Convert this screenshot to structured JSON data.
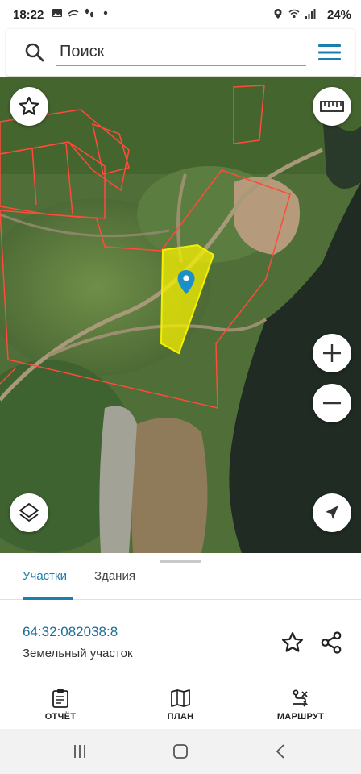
{
  "status_bar": {
    "time": "18:22",
    "battery": "24%",
    "left_icons": [
      "image-icon",
      "wind-icon",
      "footsteps-icon",
      "dot-icon"
    ],
    "right_icons": [
      "location-icon",
      "wifi-icon",
      "signal-icon"
    ]
  },
  "search": {
    "placeholder": "Поиск"
  },
  "map": {
    "parcel_color": "#f5f000",
    "boundary_color": "#ff4b3a",
    "marker_color": "#1b8fc9"
  },
  "sheet": {
    "tabs": [
      {
        "label": "Участки",
        "active": true
      },
      {
        "label": "Здания",
        "active": false
      }
    ],
    "parcel": {
      "number": "64:32:082038:8",
      "type": "Земельный участок"
    }
  },
  "toolbar": {
    "items": [
      {
        "label": "ОТЧЁТ",
        "icon": "clipboard-icon"
      },
      {
        "label": "ПЛАН",
        "icon": "map-book-icon"
      },
      {
        "label": "МАРШРУТ",
        "icon": "route-icon"
      }
    ]
  },
  "accent_color": "#1b7fad"
}
